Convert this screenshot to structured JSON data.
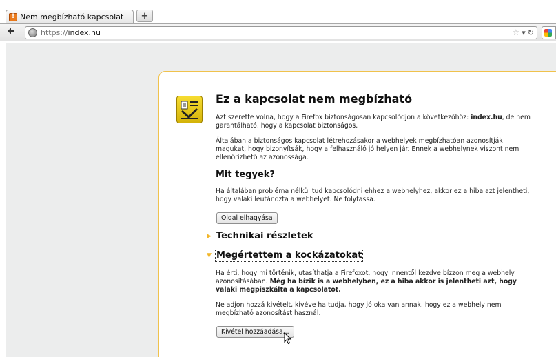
{
  "browser": {
    "tab_title": "Nem megbízható kapcsolat",
    "newtab_icon": "plus-icon",
    "url_scheme": "https://",
    "url_host": "index.hu"
  },
  "error": {
    "title": "Ez a kapcsolat nem megbízható",
    "intro_text": "Azt szerette volna, hogy a Firefox biztonságosan kapcsolódjon a következőhöz: ",
    "intro_host": "index.hu",
    "intro_text_end": ", de nem garantálható, hogy a kapcsolat biztonságos.",
    "explanation": "Általában a biztonságos kapcsolat létrehozásakor a webhelyek megbízhatóan azonosítják magukat, hogy bizonyítsák, hogy a felhasználó jó helyen jár. Ennek a webhelynek viszont nem ellenőrizhető az azonossága.",
    "what_to_do_title": "Mit tegyek?",
    "what_to_do_text": "Ha általában probléma nélkül tud kapcsolódni ehhez a webhelyhez, akkor ez a hiba azt jelentheti, hogy valaki leutánozta a webhelyet. Ne folytassa.",
    "leave_button": "Oldal elhagyása",
    "technical_title": "Technikai részletek",
    "risks_title": "Megértettem a kockázatokat",
    "risks_text": "Ha érti, hogy mi történik, utasíthatja a Firefoxot, hogy innentől kezdve bízzon meg a webhely azonosításában. ",
    "risks_bold": "Még ha bízik is a webhelyben, ez a hiba akkor is jelentheti azt, hogy valaki megpiszkálta a kapcsolatot.",
    "risks_warning": "Ne adjon hozzá kivételt, kivéve ha tudja, hogy jó oka van annak, hogy ez a webhely nem megbízható azonosítást használ.",
    "add_exception_button": "Kivétel hozzáadása..."
  },
  "colors": {
    "accent_border": "#f0c24c",
    "shield_yellow": "#f6dc31",
    "arrow": "#f2b629"
  }
}
